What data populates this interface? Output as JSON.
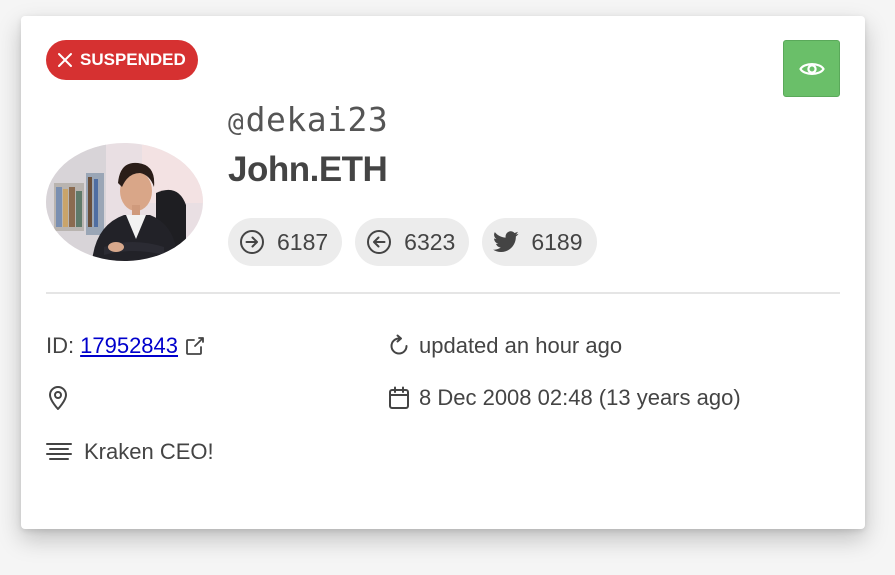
{
  "status_badge": {
    "label": "SUSPENDED",
    "color": "#d63131",
    "icon": "close-icon"
  },
  "view_button": {
    "icon": "eye-icon",
    "color": "#6abf69"
  },
  "profile": {
    "at_symbol": "@",
    "username": "dekai23",
    "display_name": "John.ETH",
    "avatar": "profile-photo"
  },
  "stats": [
    {
      "icon": "following-arrow-right-icon",
      "value": "6187"
    },
    {
      "icon": "followers-arrow-left-icon",
      "value": "6323"
    },
    {
      "icon": "twitter-bird-icon",
      "value": "6189"
    }
  ],
  "details": {
    "id_label": "ID:",
    "id_value": "17952843",
    "updated": "updated an hour ago",
    "location": "",
    "created": "8 Dec 2008 02:48 (13 years ago)",
    "bio": "Kraken CEO!"
  }
}
